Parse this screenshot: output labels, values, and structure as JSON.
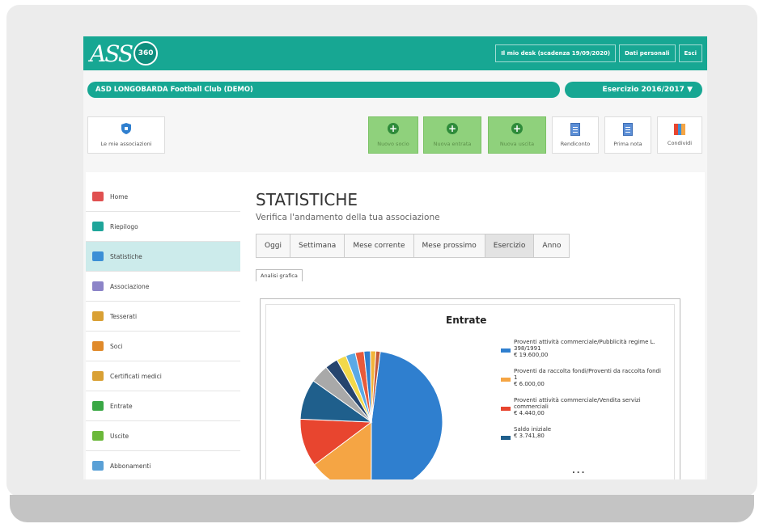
{
  "header": {
    "logo_text": "ASS",
    "logo_badge": "360",
    "links": [
      "Il mio desk (scadenza 19/09/2020)",
      "Dati personali",
      "Esci"
    ]
  },
  "club_name": "ASD LONGOBARDA Football Club (DEMO)",
  "fiscal_year": "Esercizio 2016/2017 ▼",
  "toolbar": {
    "associations": "Le mie associazioni",
    "new_member": "Nuovo socio",
    "new_income": "Nuova entrata",
    "new_expense": "Nuova uscita",
    "report": "Rendiconto",
    "first_note": "Prima nota",
    "share": "Condividi"
  },
  "sidebar": {
    "items": [
      {
        "label": "Home",
        "icon": "home-icon",
        "color": "#e05050"
      },
      {
        "label": "Riepilogo",
        "icon": "summary-icon",
        "color": "#1fa59a"
      },
      {
        "label": "Statistiche",
        "icon": "statistics-icon",
        "color": "#3c8fd6"
      },
      {
        "label": "Associazione",
        "icon": "association-icon",
        "color": "#8c84c8"
      },
      {
        "label": "Tesserati",
        "icon": "members-card-icon",
        "color": "#d9a034"
      },
      {
        "label": "Soci",
        "icon": "members-icon",
        "color": "#e08a2a"
      },
      {
        "label": "Certificati medici",
        "icon": "medical-certificate-icon",
        "color": "#d9a034"
      },
      {
        "label": "Entrate",
        "icon": "income-icon",
        "color": "#3aa845"
      },
      {
        "label": "Uscite",
        "icon": "expense-icon",
        "color": "#6bb83a"
      },
      {
        "label": "Abbonamenti",
        "icon": "subscriptions-icon",
        "color": "#5aa0d6"
      }
    ]
  },
  "page": {
    "title": "STATISTICHE",
    "subtitle": "Verifica l'andamento della tua associazione",
    "tabs": [
      "Oggi",
      "Settimana",
      "Mese corrente",
      "Mese prossimo",
      "Esercizio",
      "Anno"
    ],
    "active_tab": "Esercizio",
    "subtab": "Analisi grafica"
  },
  "chart_data": {
    "type": "pie",
    "title": "Entrate",
    "slices": [
      {
        "label": "Proventi attività commerciale/Pubblicità regime L. 398/1991",
        "value": 19600.0,
        "display": "€ 19.600,00",
        "color": "#2f7fcf"
      },
      {
        "label": "Proventi da raccolta fondi/Proventi da raccolta fondi 1",
        "value": 6000.0,
        "display": "€ 6.000,00",
        "color": "#f5a544"
      },
      {
        "label": "Proventi attività commerciale/Vendita servizi commerciali",
        "value": 4440.0,
        "display": "€ 4.440,00",
        "color": "#e8452f"
      },
      {
        "label": "Saldo iniziale",
        "value": 3741.8,
        "display": "€ 3.741,80",
        "color": "#1f5f8c"
      },
      {
        "label": "",
        "value": 1700,
        "color": "#a9a9a9"
      },
      {
        "label": "",
        "value": 1200,
        "color": "#26456e"
      },
      {
        "label": "",
        "value": 900,
        "color": "#f3d94a"
      },
      {
        "label": "",
        "value": 900,
        "color": "#5aa9e6"
      },
      {
        "label": "",
        "value": 800,
        "color": "#e85a3a"
      },
      {
        "label": "",
        "value": 600,
        "color": "#2f7fcf"
      },
      {
        "label": "",
        "value": 500,
        "color": "#f2b43a"
      },
      {
        "label": "",
        "value": 400,
        "color": "#c45a3a"
      }
    ],
    "legend_more": "..."
  }
}
